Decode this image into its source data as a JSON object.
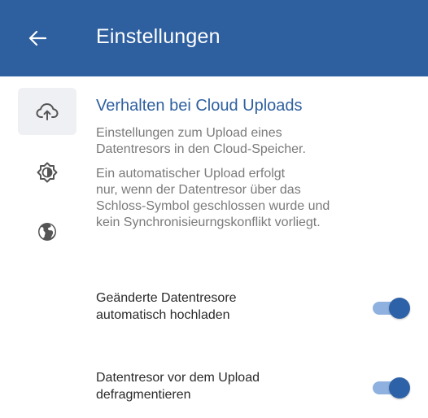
{
  "app_bar": {
    "title": "Einstellungen",
    "back_icon": "arrow-left-icon",
    "color": "#2e5f9f"
  },
  "nav_rail": {
    "items": [
      {
        "icon": "cloud-upload-icon",
        "active": true
      },
      {
        "icon": "brightness-icon",
        "active": false
      },
      {
        "icon": "globe-icon",
        "active": false
      }
    ]
  },
  "section": {
    "title": "Verhalten bei Cloud Uploads",
    "description_1": "Einstellungen zum Upload eines\nDatentresors in den Cloud-Speicher.",
    "description_2": "Ein automatischer Upload erfolgt\nnur, wenn der Datentresor über das\nSchloss-Symbol geschlossen wurde und\nkein Synchronisieurngskonflikt vorliegt."
  },
  "settings": [
    {
      "label": "Geänderte Datentresore\nautomatisch hochladen",
      "enabled": true
    },
    {
      "label": "Datentresor vor dem Upload\ndefragmentieren",
      "enabled": true
    }
  ],
  "colors": {
    "accent": "#2e5f9f",
    "switch_thumb": "#2e62a8",
    "switch_track": "#8fb1df",
    "nav_active_bg": "#eef0f3",
    "icon_gray": "#555555"
  }
}
